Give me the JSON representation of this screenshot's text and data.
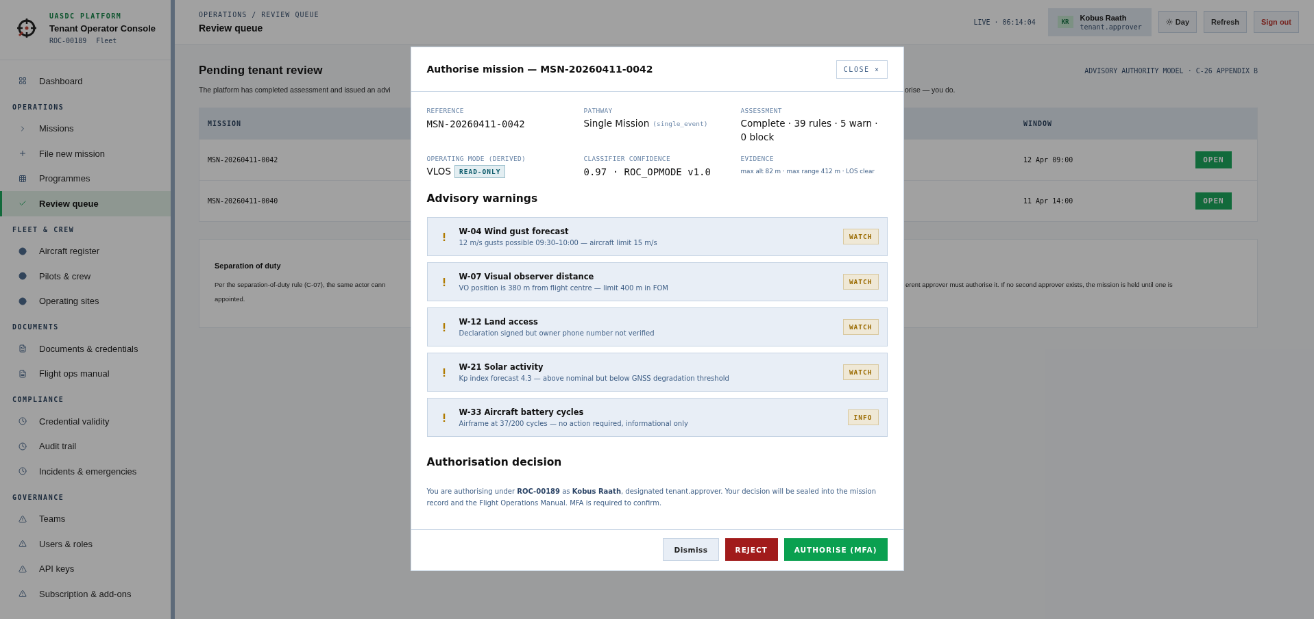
{
  "sidebar": {
    "brand": {
      "kicker": "UASDC PLATFORM",
      "title": "Tenant Operator Console",
      "meta": [
        "ROC-00189",
        "Fleet"
      ]
    },
    "sections": [
      {
        "items": [
          {
            "label": "Dashboard",
            "selected": false
          }
        ]
      },
      {
        "heading": "OPERATIONS",
        "items": [
          {
            "label": "Missions",
            "selected": false
          },
          {
            "label": "File new mission",
            "selected": false
          },
          {
            "label": "Programmes",
            "selected": false
          },
          {
            "label": "Review queue",
            "selected": true
          }
        ]
      },
      {
        "heading": "FLEET & CREW",
        "items": [
          {
            "label": "Aircraft register",
            "selected": false
          },
          {
            "label": "Pilots & crew",
            "selected": false
          },
          {
            "label": "Operating sites",
            "selected": false
          }
        ]
      },
      {
        "heading": "DOCUMENTS",
        "items": [
          {
            "label": "Documents & credentials",
            "selected": false
          },
          {
            "label": "Flight ops manual",
            "selected": false
          }
        ]
      },
      {
        "heading": "COMPLIANCE",
        "items": [
          {
            "label": "Credential validity",
            "selected": false
          },
          {
            "label": "Audit trail",
            "selected": false
          },
          {
            "label": "Incidents & emergencies",
            "selected": false
          }
        ]
      },
      {
        "heading": "GOVERNANCE",
        "items": [
          {
            "label": "Teams",
            "selected": false
          },
          {
            "label": "Users & roles",
            "selected": false
          },
          {
            "label": "API keys",
            "selected": false
          },
          {
            "label": "Subscription & add-ons",
            "selected": false
          }
        ]
      }
    ]
  },
  "header": {
    "breadcrumb": "OPERATIONS / REVIEW QUEUE",
    "title": "Review queue",
    "status": "LIVE · 06:14:04",
    "user": {
      "initials": "KR",
      "name": "Kobus Raath",
      "role": "tenant.approver"
    },
    "buttons": [
      {
        "label": "Day",
        "kind": "theme"
      },
      {
        "label": "Refresh",
        "kind": "plain"
      },
      {
        "label": "Sign out",
        "kind": "danger"
      }
    ]
  },
  "page": {
    "title": "Pending tenant review",
    "model_note": "ADVISORY AUTHORITY MODEL · C-26 APPENDIX B",
    "lead_left": "The platform has completed assessment and issued an advi",
    "lead_right": "orise — you do.",
    "table": {
      "columns": [
        {
          "label": "MISSION"
        },
        {
          "label": "WINDOW"
        }
      ],
      "rows": [
        {
          "mission": "MSN-20260411-0042",
          "window": "12 Apr 09:00",
          "action": "OPEN"
        },
        {
          "mission": "MSN-20260411-0040",
          "window": "11 Apr 14:00",
          "action": "OPEN"
        }
      ]
    },
    "duty": {
      "title": "Separation of duty",
      "line1_left": "Per the separation-of-duty rule (C-07), the same actor cann",
      "line1_right": "erent approver must authorise it. If no second approver exists, the mission is held until one is",
      "line2": "appointed."
    }
  },
  "modal": {
    "title": "Authorise mission — MSN-20260411-0042",
    "close": "CLOSE ×",
    "fields": [
      {
        "label": "REFERENCE",
        "value": "MSN-20260411-0042",
        "kind": "mono"
      },
      {
        "label": "PATHWAY",
        "value": "Single Mission",
        "note": "(single_event)",
        "kind": "text"
      },
      {
        "label": "ASSESSMENT",
        "value": "Complete · 39 rules · 5 warn · 0 block",
        "kind": "text"
      },
      {
        "label": "OPERATING MODE (DERIVED)",
        "value": "VLOS",
        "badge": "READ-ONLY",
        "kind": "text"
      },
      {
        "label": "CLASSIFIER CONFIDENCE",
        "value": "0.97 · ROC_OPMODE v1.0",
        "kind": "mono"
      },
      {
        "label": "EVIDENCE",
        "value": "max alt 82 m · max range 412 m · LOS clear",
        "kind": "small"
      }
    ],
    "warnings_title": "Advisory warnings",
    "warnings": [
      {
        "title": "W-04 Wind gust forecast",
        "detail": "12 m/s gusts possible 09:30–10:00 — aircraft limit 15 m/s",
        "level": "WATCH"
      },
      {
        "title": "W-07 Visual observer distance",
        "detail": "VO position is 380 m from flight centre — limit 400 m in FOM",
        "level": "WATCH"
      },
      {
        "title": "W-12 Land access",
        "detail": "Declaration signed but owner phone number not verified",
        "level": "WATCH"
      },
      {
        "title": "W-21 Solar activity",
        "detail": "Kp index forecast 4.3 — above nominal but below GNSS degradation threshold",
        "level": "WATCH"
      },
      {
        "title": "W-33 Aircraft battery cycles",
        "detail": "Airframe at 37/200 cycles — no action required, informational only",
        "level": "INFO"
      }
    ],
    "decision_title": "Authorisation decision",
    "decision_text": "You are authorising under **ROC-00189** as **Kobus Raath**, designated tenant.approver. Your decision will be sealed into the mission record and the Flight Operations Manual. MFA is required to confirm.",
    "buttons": [
      {
        "label": "Dismiss",
        "kind": "secondary"
      },
      {
        "label": "REJECT",
        "kind": "reject"
      },
      {
        "label": "AUTHORISE (MFA)",
        "kind": "approve"
      }
    ]
  }
}
